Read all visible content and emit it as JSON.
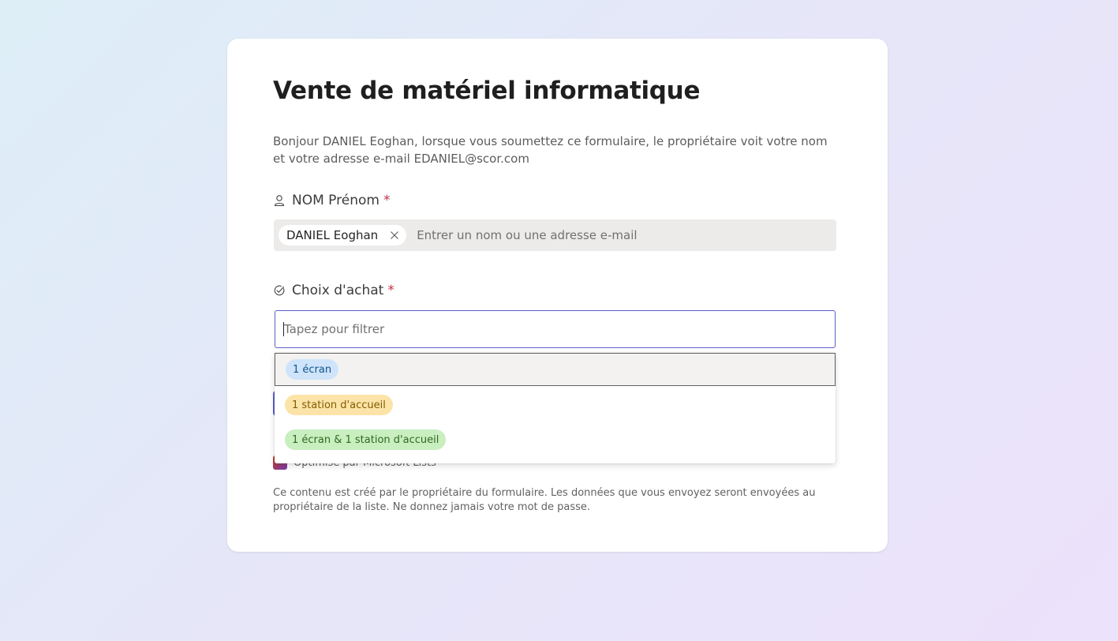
{
  "form": {
    "title": "Vente de matériel informatique",
    "intro": "Bonjour DANIEL Eoghan, lorsque vous soumettez ce formulaire, le propriétaire voit votre nom et votre adresse e-mail EDANIEL@scor.com"
  },
  "fields": {
    "name": {
      "label": "NOM Prénom",
      "required_mark": "*",
      "icon": "person-icon",
      "selected_person": "DANIEL Eoghan",
      "placeholder": "Entrer un nom ou une adresse e-mail"
    },
    "choice": {
      "label": "Choix d'achat",
      "required_mark": "*",
      "icon": "choice-check-icon",
      "filter_placeholder": "Tapez pour filtrer",
      "options": [
        {
          "label": "1 écran",
          "bg": "#cfe4fa",
          "fg": "#0f548c"
        },
        {
          "label": "1 station d'accueil",
          "bg": "#fce4a8",
          "fg": "#835b00"
        },
        {
          "label": "1 écran & 1 station d'accueil",
          "bg": "#c9eec0",
          "fg": "#2d6a1f"
        }
      ]
    }
  },
  "footer": {
    "powered_by": "Optimisé par Microsoft Lists",
    "disclaimer": "Ce contenu est créé par le propriétaire du formulaire. Les données que vous envoyez seront envoyées au propriétaire de la liste. Ne donnez jamais votre mot de passe."
  },
  "colors": {
    "accent": "#5b5fc7",
    "required": "#c4314b"
  }
}
